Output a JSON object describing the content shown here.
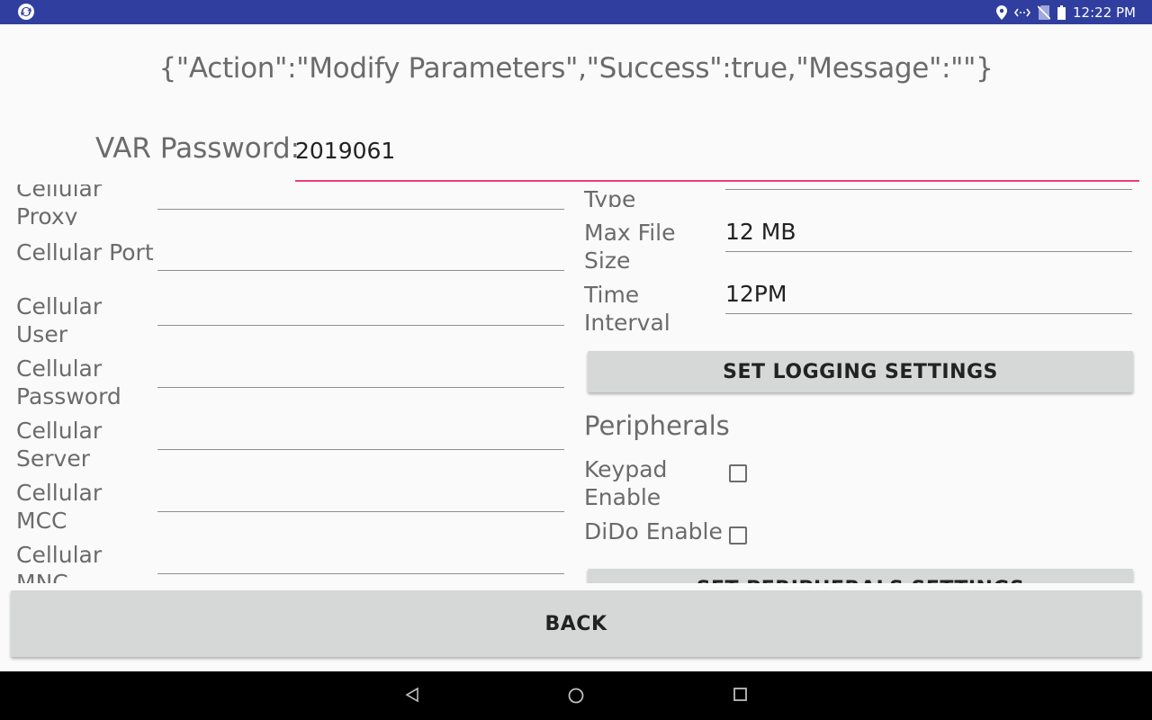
{
  "status_bar": {
    "time": "12:22 PM",
    "icons": [
      "app-logo-icon",
      "location-icon",
      "data-transfer-icon",
      "no-sim-icon",
      "battery-icon"
    ]
  },
  "response_text": "{\"Action\":\"Modify Parameters\",\"Success\":true,\"Message\":\"\"}",
  "password": {
    "label": "VAR Password:",
    "value": "2019061"
  },
  "left_fields": [
    {
      "label": "Cellular Proxy",
      "value": ""
    },
    {
      "label": "Cellular Port",
      "value": ""
    },
    {
      "label": "Cellular User",
      "value": ""
    },
    {
      "label": "Cellular Password",
      "value": ""
    },
    {
      "label": "Cellular Server",
      "value": ""
    },
    {
      "label": "Cellular MCC",
      "value": ""
    },
    {
      "label": "Cellular MNC",
      "value": ""
    }
  ],
  "right_fields": [
    {
      "label": "Type",
      "value": ""
    },
    {
      "label": "Max File Size",
      "value": "12 MB"
    },
    {
      "label": "Time Interval",
      "value": "12PM"
    }
  ],
  "buttons": {
    "set_logging": "SET LOGGING SETTINGS",
    "set_peripherals": "SET PERIPHERALS SETTINGS",
    "back": "BACK"
  },
  "peripherals": {
    "title": "Peripherals",
    "items": [
      {
        "label": "Keypad Enable",
        "checked": false
      },
      {
        "label": "DiDo Enable",
        "checked": false
      }
    ]
  },
  "nav_bar": {
    "icons": [
      "back-nav-icon",
      "home-nav-icon",
      "recents-nav-icon"
    ]
  }
}
